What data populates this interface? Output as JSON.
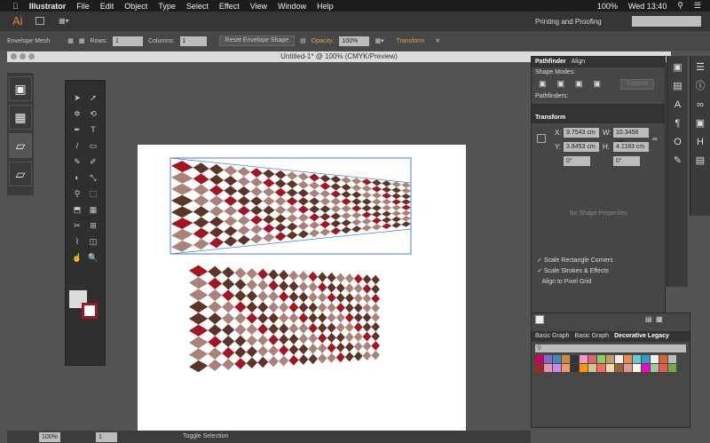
{
  "menubar": {
    "app": "Illustrator",
    "items": [
      "File",
      "Edit",
      "Object",
      "Type",
      "Select",
      "Effect",
      "View",
      "Window",
      "Help"
    ],
    "battery": "100%",
    "clock": "Wed 13:40"
  },
  "appbar": {
    "logo": "Ai",
    "workspace": "Printing and Proofing"
  },
  "control": {
    "mode": "Envelope Mesh",
    "rows_label": "Rows:",
    "rows": "1",
    "cols_label": "Columns:",
    "cols": "1",
    "reset": "Reset Envelope Shape",
    "opacity_label": "Opacity:",
    "opacity": "100%",
    "transform": "Transform"
  },
  "document": {
    "title": "Untitled-1* @ 100% (CMYK/Preview)"
  },
  "pathfinder": {
    "tabs": [
      "Pathfinder",
      "Align"
    ],
    "shape_modes": "Shape Modes:",
    "expand": "Expand",
    "pathfinders": "Pathfinders:"
  },
  "transform": {
    "title": "Transform",
    "x_label": "X:",
    "x": "9.7543 cm",
    "w_label": "W:",
    "w": "10.3458 cm",
    "y_label": "Y:",
    "y": "3.8453 cm",
    "h_label": "H:",
    "h": "4.1183 cm",
    "angle": "0°",
    "shear": "0°",
    "no_shape": "No Shape Properties",
    "opts": [
      "Scale Rectangle Corners",
      "Scale Strokes & Effects",
      "Align to Pixel Grid"
    ],
    "opts_checked": [
      true,
      true,
      false
    ]
  },
  "swatches": {
    "tabs": [
      "Basic Graph",
      "Basic Graph",
      "Decorative Legacy"
    ]
  },
  "status": {
    "zoom": "100%",
    "page": "1",
    "toggle": "Toggle Selection"
  },
  "colors": {
    "red": "#a31621",
    "brown": "#5c3526",
    "tan": "#a8837a",
    "white": "#ffffff",
    "accent": "#e8a04a"
  }
}
